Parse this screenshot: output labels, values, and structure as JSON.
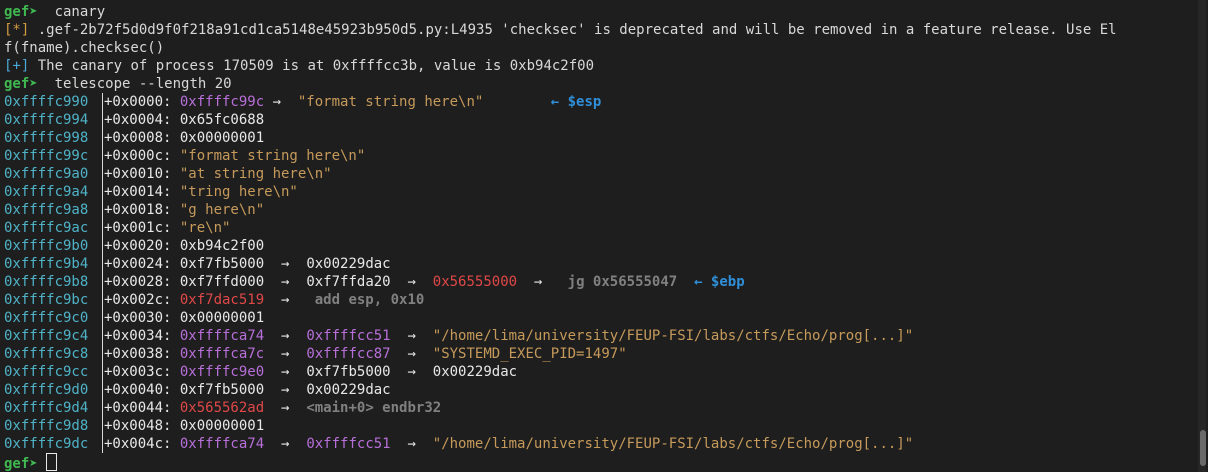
{
  "terminal": {
    "prompt": "gef➤",
    "commands": [
      "canary",
      "telescope --length 20"
    ],
    "warn_tag": "[*]",
    "warning_line1": " .gef-2b72f5d0d9f0f218a91cd1ca5148e45923b950d5.py:L4935 'checksec' is deprecated and will be removed in a feature release. Use El",
    "warning_line2": "f(fname).checksec()",
    "info_tag": "[+]",
    "info_text": " The canary of process 170509 is at 0xffffcc3b, value is 0xb94c2f00",
    "arrow": "→",
    "left_arrow": "←",
    "rows": [
      {
        "addr": "0xffffc990",
        "off": "+0x0000:",
        "parts": [
          [
            "stack",
            "0xffffc99c"
          ],
          [
            "arrow",
            " → "
          ],
          [
            "str",
            " \"format string here\\n\""
          ],
          [
            "sp",
            "        "
          ],
          [
            "reg",
            "← $esp"
          ]
        ]
      },
      {
        "addr": "0xffffc994",
        "off": "+0x0004:",
        "parts": [
          [
            "plain",
            "0x65fc0688"
          ]
        ]
      },
      {
        "addr": "0xffffc998",
        "off": "+0x0008:",
        "parts": [
          [
            "plain",
            "0x00000001"
          ]
        ]
      },
      {
        "addr": "0xffffc99c",
        "off": "+0x000c:",
        "parts": [
          [
            "str",
            "\"format string here\\n\""
          ]
        ]
      },
      {
        "addr": "0xffffc9a0",
        "off": "+0x0010:",
        "parts": [
          [
            "str",
            "\"at string here\\n\""
          ]
        ]
      },
      {
        "addr": "0xffffc9a4",
        "off": "+0x0014:",
        "parts": [
          [
            "str",
            "\"tring here\\n\""
          ]
        ]
      },
      {
        "addr": "0xffffc9a8",
        "off": "+0x0018:",
        "parts": [
          [
            "str",
            "\"g here\\n\""
          ]
        ]
      },
      {
        "addr": "0xffffc9ac",
        "off": "+0x001c:",
        "parts": [
          [
            "str",
            "\"re\\n\""
          ]
        ]
      },
      {
        "addr": "0xffffc9b0",
        "off": "+0x0020:",
        "parts": [
          [
            "plain",
            "0xb94c2f00"
          ]
        ]
      },
      {
        "addr": "0xffffc9b4",
        "off": "+0x0024:",
        "parts": [
          [
            "plain",
            "0xf7fb5000"
          ],
          [
            "arrow",
            "  →  "
          ],
          [
            "plain",
            "0x00229dac"
          ]
        ]
      },
      {
        "addr": "0xffffc9b8",
        "off": "+0x0028:",
        "parts": [
          [
            "plain",
            "0xf7ffd000"
          ],
          [
            "arrow",
            "  →  "
          ],
          [
            "plain",
            "0xf7ffda20"
          ],
          [
            "arrow",
            "  →  "
          ],
          [
            "code",
            "0x56555000"
          ],
          [
            "arrow",
            "  →   "
          ],
          [
            "dim",
            "jg 0x56555047"
          ],
          [
            "sp",
            "  "
          ],
          [
            "reg",
            "← $ebp"
          ]
        ]
      },
      {
        "addr": "0xffffc9bc",
        "off": "+0x002c:",
        "parts": [
          [
            "code",
            "0xf7dac519"
          ],
          [
            "arrow",
            "  →   "
          ],
          [
            "dim",
            "add esp, 0x10"
          ]
        ]
      },
      {
        "addr": "0xffffc9c0",
        "off": "+0x0030:",
        "parts": [
          [
            "plain",
            "0x00000001"
          ]
        ]
      },
      {
        "addr": "0xffffc9c4",
        "off": "+0x0034:",
        "parts": [
          [
            "stack",
            "0xffffca74"
          ],
          [
            "arrow",
            "  →  "
          ],
          [
            "stack",
            "0xffffcc51"
          ],
          [
            "arrow",
            "  →  "
          ],
          [
            "str",
            "\"/home/lima/university/FEUP-FSI/labs/ctfs/Echo/prog[...]\""
          ]
        ]
      },
      {
        "addr": "0xffffc9c8",
        "off": "+0x0038:",
        "parts": [
          [
            "stack",
            "0xffffca7c"
          ],
          [
            "arrow",
            "  →  "
          ],
          [
            "stack",
            "0xffffcc87"
          ],
          [
            "arrow",
            "  →  "
          ],
          [
            "str",
            "\"SYSTEMD_EXEC_PID=1497\""
          ]
        ]
      },
      {
        "addr": "0xffffc9cc",
        "off": "+0x003c:",
        "parts": [
          [
            "stack",
            "0xffffc9e0"
          ],
          [
            "arrow",
            "  →  "
          ],
          [
            "plain",
            "0xf7fb5000"
          ],
          [
            "arrow",
            "  →  "
          ],
          [
            "plain",
            "0x00229dac"
          ]
        ]
      },
      {
        "addr": "0xffffc9d0",
        "off": "+0x0040:",
        "parts": [
          [
            "plain",
            "0xf7fb5000"
          ],
          [
            "arrow",
            "  →  "
          ],
          [
            "plain",
            "0x00229dac"
          ]
        ]
      },
      {
        "addr": "0xffffc9d4",
        "off": "+0x0044:",
        "parts": [
          [
            "code",
            "0x565562ad"
          ],
          [
            "arrow",
            "  →  "
          ],
          [
            "dim",
            "<main+0> endbr32"
          ]
        ]
      },
      {
        "addr": "0xffffc9d8",
        "off": "+0x0048:",
        "parts": [
          [
            "plain",
            "0x00000001"
          ]
        ]
      },
      {
        "addr": "0xffffc9dc",
        "off": "+0x004c:",
        "parts": [
          [
            "stack",
            "0xffffca74"
          ],
          [
            "arrow",
            "  →  "
          ],
          [
            "stack",
            "0xffffcc51"
          ],
          [
            "arrow",
            "  →  "
          ],
          [
            "str",
            "\"/home/lima/university/FEUP-FSI/labs/ctfs/Echo/prog[...]\""
          ]
        ]
      }
    ]
  }
}
